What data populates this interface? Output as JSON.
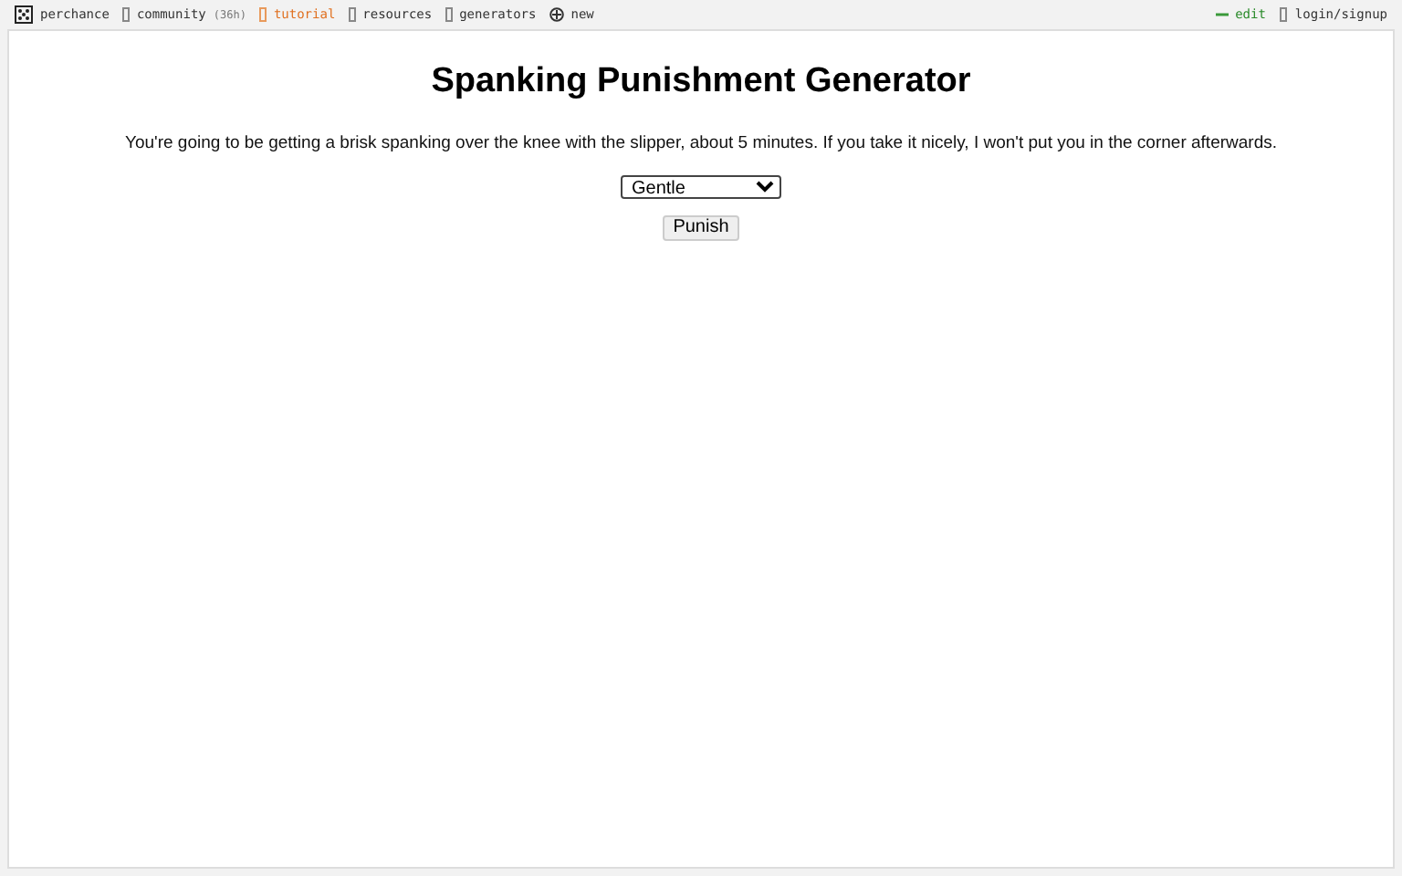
{
  "nav": {
    "left": [
      {
        "kind": "logo",
        "label": "perchance"
      },
      {
        "kind": "box",
        "label": "community",
        "count": "(36h)"
      },
      {
        "kind": "highlight",
        "label": "tutorial"
      },
      {
        "kind": "box",
        "label": "resources"
      },
      {
        "kind": "box",
        "label": "generators"
      },
      {
        "kind": "plus",
        "label": "new"
      }
    ],
    "right": [
      {
        "kind": "edit",
        "label": "edit"
      },
      {
        "kind": "box",
        "label": "login/signup"
      }
    ]
  },
  "title": "Spanking Punishment Generator",
  "output": "You're going to be getting a brisk spanking over the knee with the slipper, about 5 minutes. If you take it nicely, I won't put you in the corner afterwards.",
  "select": {
    "value": "Gentle"
  },
  "button": "Punish"
}
